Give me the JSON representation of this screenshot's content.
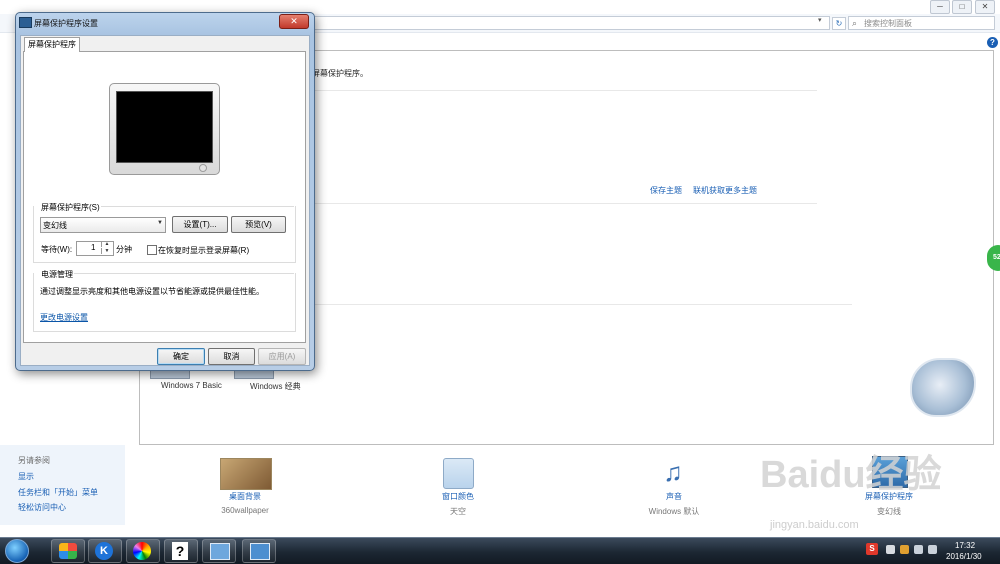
{
  "control_panel": {
    "window_buttons": [
      "─",
      "□",
      "✕"
    ],
    "search_placeholder": "搜索控制面板",
    "help_icon": "?",
    "desc_fragment": "屏幕保护程序。",
    "save_theme": "保存主题",
    "get_more_themes": "联机获取更多主题",
    "themes": [
      "Windows 7 Basic",
      "Windows 经典"
    ],
    "see_also_header": "另请参阅",
    "see_also_links": [
      "显示",
      "任务栏和「开始」菜单",
      "轻松访问中心"
    ],
    "bottom_items": [
      {
        "title": "桌面背景",
        "subtitle": "360wallpaper"
      },
      {
        "title": "窗口颜色",
        "subtitle": "天空"
      },
      {
        "title": "声音",
        "subtitle": "Windows 默认"
      },
      {
        "title": "屏幕保护程序",
        "subtitle": "变幻线"
      }
    ],
    "badge_text": "52",
    "watermark": "Baidu经验",
    "watermark_url": "jingyan.baidu.com"
  },
  "dialog": {
    "title": "屏幕保护程序设置",
    "close_glyph": "✕",
    "tab": "屏幕保护程序",
    "saver_group_label": "屏幕保护程序(S)",
    "saver_selected": "变幻线",
    "settings_button": "设置(T)...",
    "preview_button": "预览(V)",
    "wait_label": "等待(W):",
    "wait_value": "1",
    "wait_unit": "分钟",
    "resume_checkbox_label": "在恢复时显示登录屏幕(R)",
    "resume_checked": false,
    "power_group_label": "电源管理",
    "power_desc": "通过调整显示亮度和其他电源设置以节省能源或提供最佳性能。",
    "power_link": "更改电源设置",
    "ok": "确定",
    "cancel": "取消",
    "apply": "应用(A)"
  },
  "taskbar": {
    "tb2_letter": "K",
    "tb4_glyph": "?",
    "tray_s": "S",
    "time": "17:32",
    "date": "2016/1/30"
  }
}
